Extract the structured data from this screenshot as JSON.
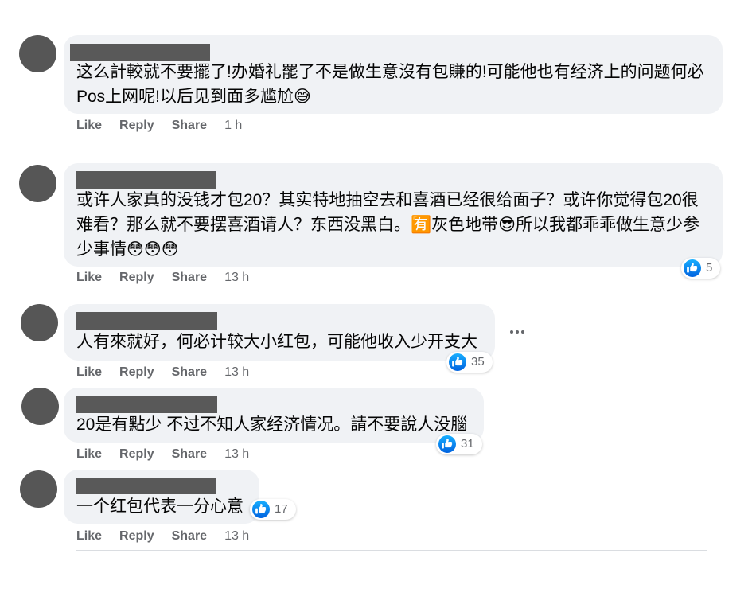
{
  "theme": {
    "bubble_bg": "#f0f2f5",
    "accent": "#1877f2",
    "action_text": "#65676b",
    "redaction": "#595959",
    "avatar": "#565656"
  },
  "comments": [
    {
      "text": "这么計較就不要擺了!办婚礼罷了不是做生意沒有包賺的!可能他也有经济上的问题何必Pos上网呢!以后见到面多尴尬😅",
      "like": "Like",
      "reply": "Reply",
      "share": "Share",
      "time": "1 h"
    },
    {
      "text": "或许人家真的没钱才包20？其实特地抽空去和喜酒已经很给面子？或许你觉得包20很难看？那么就不要摆喜酒请人？东西没黑白。🈶灰色地带😎所以我都乖乖做生意少参少事情😳😳😳",
      "like": "Like",
      "reply": "Reply",
      "share": "Share",
      "time": "13 h",
      "reaction": {
        "icon": "thumbs-up-icon",
        "count": "5"
      }
    },
    {
      "text": "人有來就好，何必计较大小红包，可能他收入少开支大",
      "like": "Like",
      "reply": "Reply",
      "share": "Share",
      "time": "13 h",
      "reaction": {
        "icon": "thumbs-up-icon",
        "count": "35"
      },
      "more_options_icon": "more-options-icon"
    },
    {
      "text": "20是有點少 不过不知人家经济情况。請不要說人没腦",
      "like": "Like",
      "reply": "Reply",
      "share": "Share",
      "time": "13 h",
      "reaction": {
        "icon": "thumbs-up-icon",
        "count": "31"
      }
    },
    {
      "text": "一个红包代表一分心意",
      "like": "Like",
      "reply": "Reply",
      "share": "Share",
      "time": "13 h",
      "reaction": {
        "icon": "thumbs-up-icon",
        "count": "17"
      }
    }
  ]
}
